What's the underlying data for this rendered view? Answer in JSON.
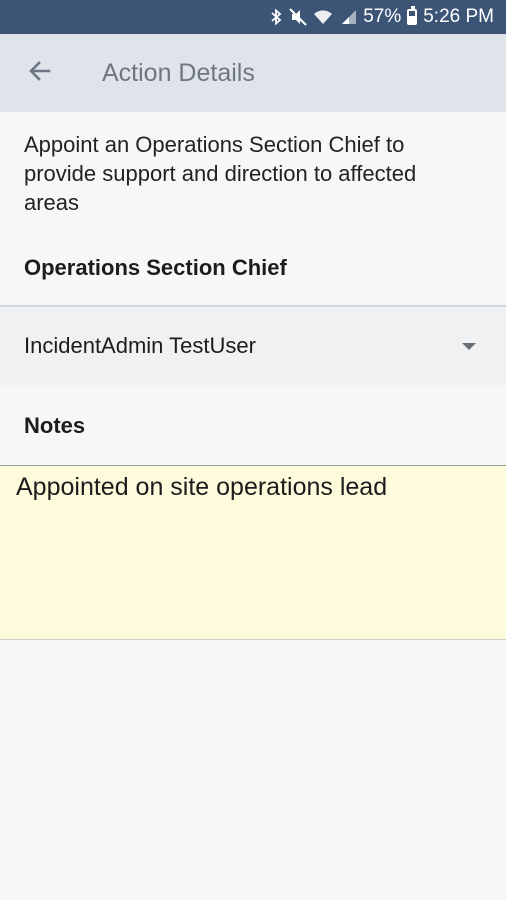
{
  "status_bar": {
    "battery": "57%",
    "time": "5:26 PM",
    "icons": [
      "bluetooth-icon",
      "mute-icon",
      "wifi-icon",
      "signal-icon",
      "battery-icon"
    ]
  },
  "app_bar": {
    "title": "Action Details",
    "back_icon": "arrow-left-icon"
  },
  "action": {
    "description": "Appoint an Operations Section Chief to provide support and direction to affected areas",
    "role_label": "Operations Section Chief",
    "assignee_selected": "IncidentAdmin TestUser"
  },
  "notes": {
    "label": "Notes",
    "value": "Appointed on site operations lead"
  },
  "colors": {
    "status_bar_bg": "#3c5576",
    "app_bar_bg": "#dfe3ea",
    "notes_bg": "#fefbdc"
  }
}
